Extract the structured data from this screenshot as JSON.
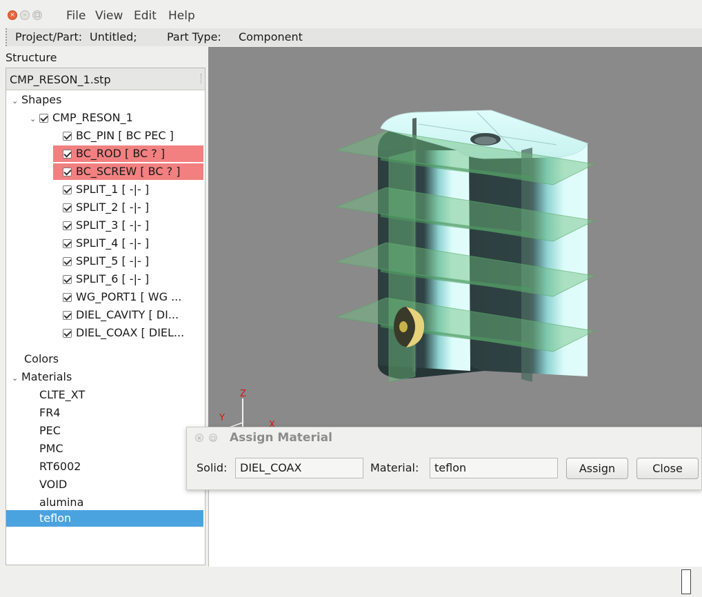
{
  "menubar": {
    "items": [
      "File",
      "View",
      "Edit",
      "Help"
    ]
  },
  "project_bar": {
    "project_label": "Project/Part:",
    "project_value": "Untitled;",
    "part_type_label": "Part Type:",
    "part_type_value": "Component"
  },
  "structure": {
    "label": "Structure",
    "file": "CMP_RESON_1.stp",
    "tree": {
      "shapes": "Shapes",
      "root": "CMP_RESON_1",
      "items": [
        {
          "label": "BC_PIN [ BC PEC ]",
          "status": "normal"
        },
        {
          "label": "BC_ROD [ BC ? ]",
          "status": "error"
        },
        {
          "label": "BC_SCREW [ BC ? ]",
          "status": "error"
        },
        {
          "label": "SPLIT_1 [ -|- ]",
          "status": "normal"
        },
        {
          "label": "SPLIT_2 [ -|- ]",
          "status": "normal"
        },
        {
          "label": "SPLIT_3 [ -|- ]",
          "status": "normal"
        },
        {
          "label": "SPLIT_4 [ -|- ]",
          "status": "normal"
        },
        {
          "label": "SPLIT_5 [ -|- ]",
          "status": "normal"
        },
        {
          "label": "SPLIT_6 [ -|- ]",
          "status": "normal"
        },
        {
          "label": "WG_PORT1 [ WG ...",
          "status": "normal"
        },
        {
          "label": "DIEL_CAVITY [ DI...",
          "status": "normal"
        },
        {
          "label": "DIEL_COAX [ DIEL...",
          "status": "normal"
        }
      ],
      "colors": "Colors",
      "materials_label": "Materials",
      "materials": [
        "CLTE_XT",
        "FR4",
        "PEC",
        "PMC",
        "RT6002",
        "VOID",
        "alumina",
        "teflon"
      ],
      "selected_material": "teflon"
    }
  },
  "viewport": {
    "axis_labels": {
      "z": "Z",
      "y": "Y",
      "x": "X"
    },
    "colors": {
      "background": "#8a8a8a",
      "body_light": "#dcfcfa",
      "body_dark": "#2f4142",
      "planes": "#6fbf7f",
      "connector": "#c8b24a"
    }
  },
  "dialog": {
    "title": "Assign Material",
    "solid_label": "Solid:",
    "solid_value": "DIEL_COAX",
    "material_label": "Material:",
    "material_value": "teflon",
    "assign_button": "Assign",
    "close_button": "Close"
  },
  "colors": {
    "error_row": "#f28080",
    "selected_row": "#4aa3df"
  }
}
